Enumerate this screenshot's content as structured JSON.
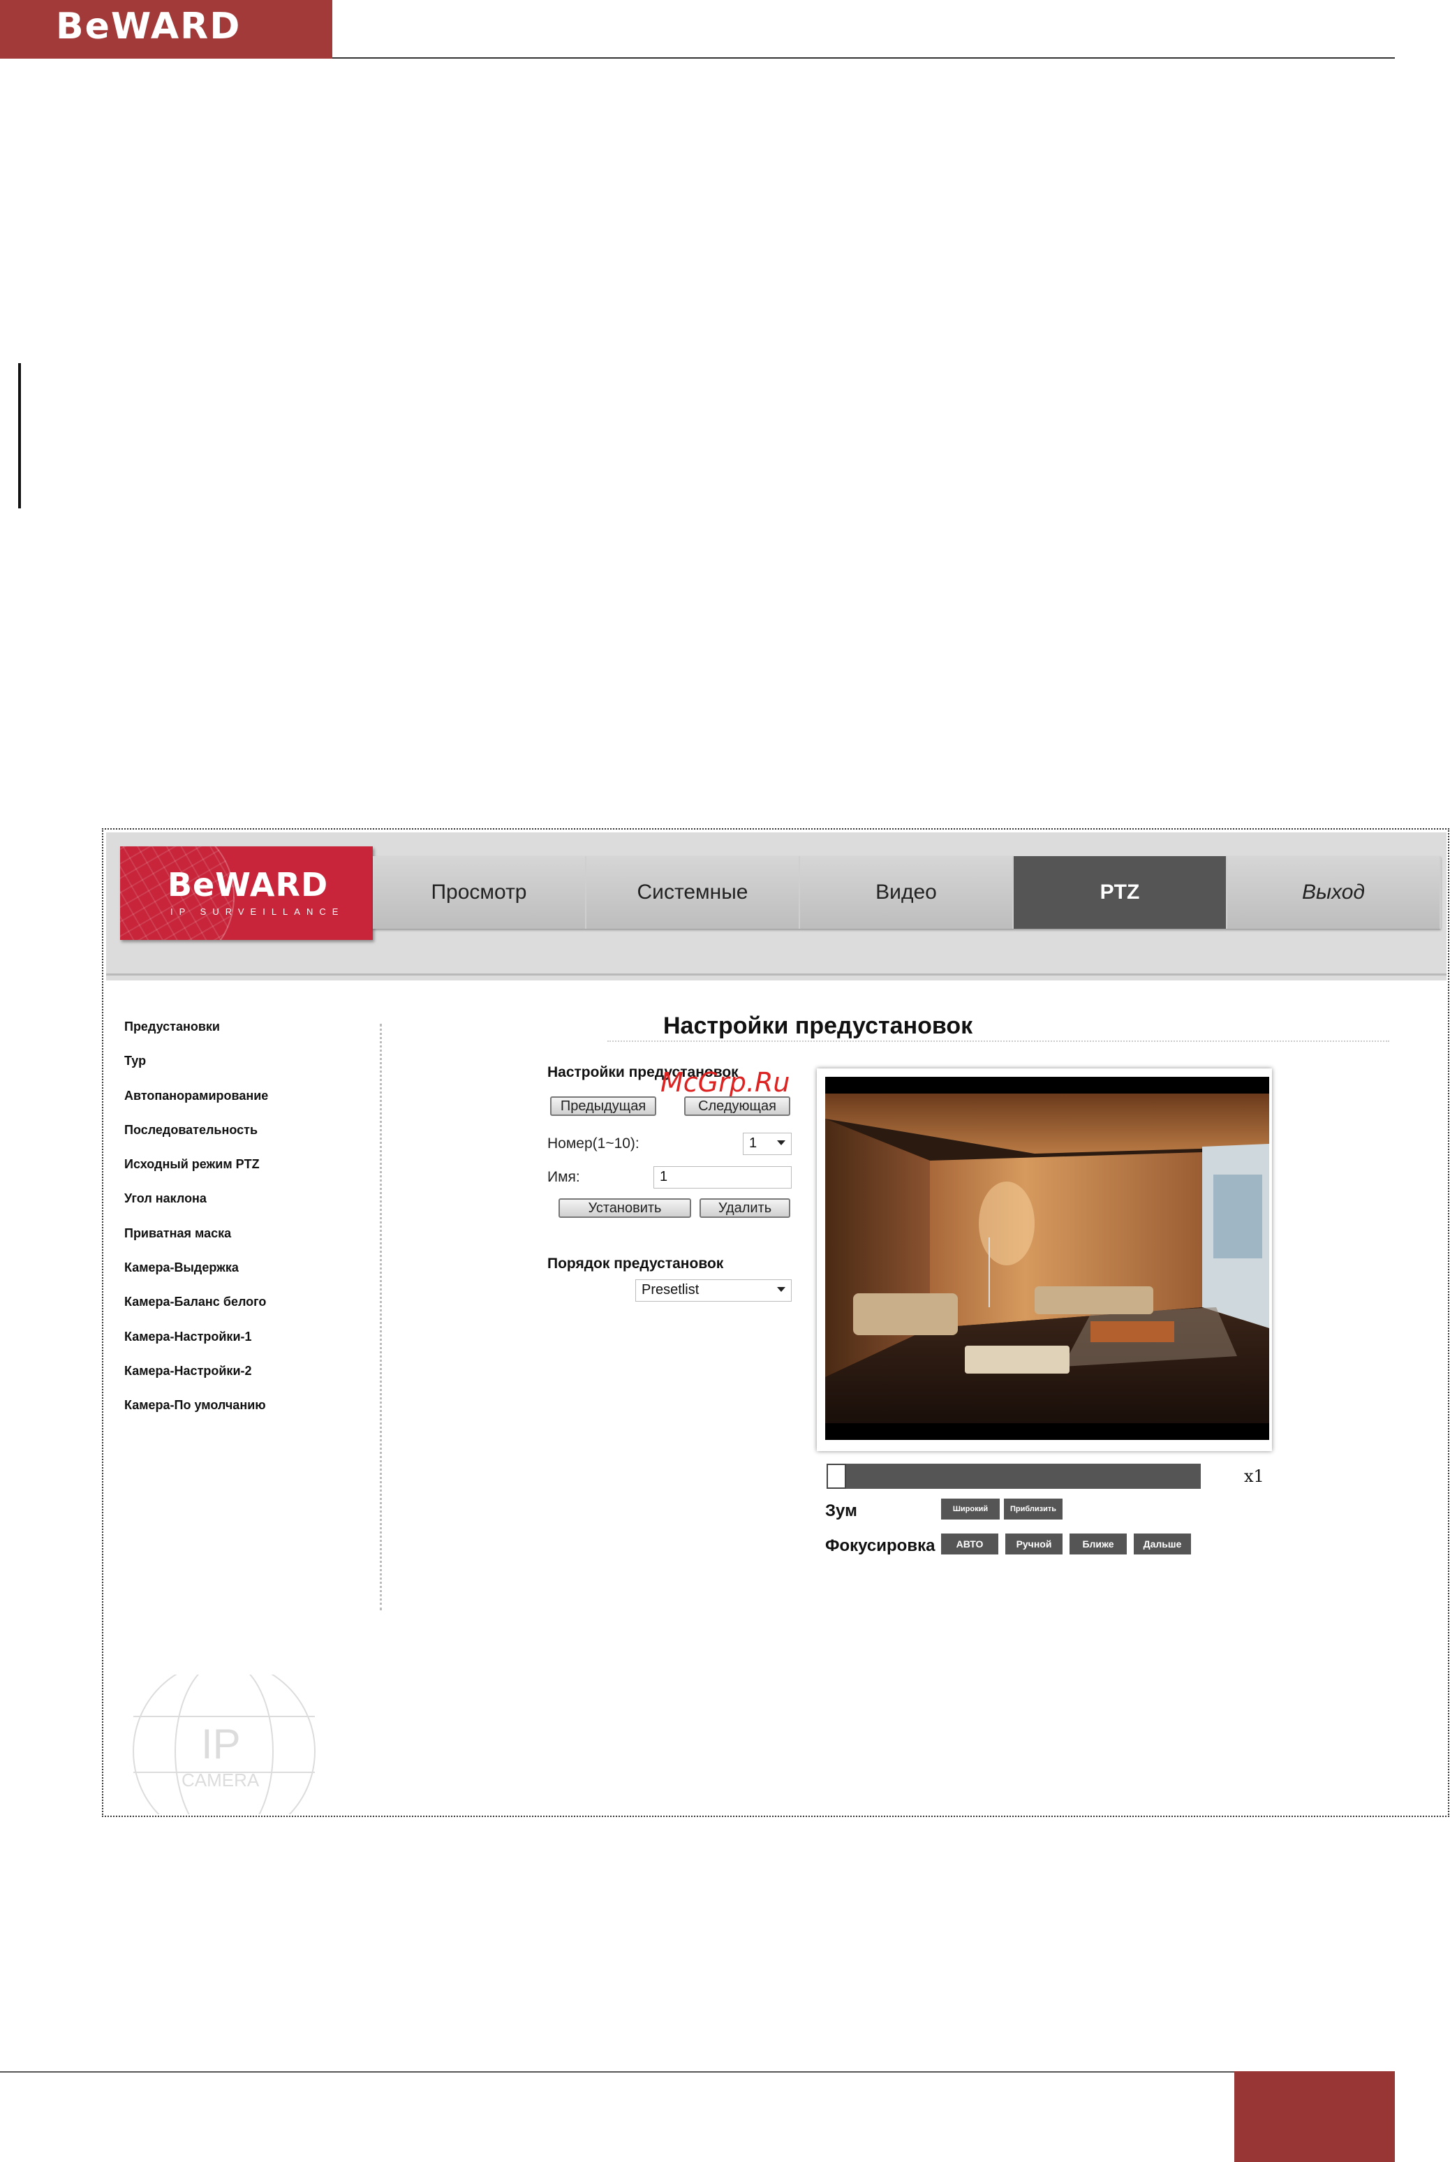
{
  "doc": {
    "brand_logo": "BeWARD",
    "colors": {
      "brand_red": "#a33a3a",
      "camera_red": "#c8243a",
      "active_tab": "#555555"
    }
  },
  "camera_ui": {
    "logo": {
      "name": "BeWARD",
      "tagline": "IP SURVEILLANCE"
    },
    "tabs": [
      {
        "label": "Просмотр",
        "active": false
      },
      {
        "label": "Системные",
        "active": false
      },
      {
        "label": "Видео",
        "active": false
      },
      {
        "label": "PTZ",
        "active": true
      },
      {
        "label": "Выход",
        "active": false
      }
    ],
    "menu": [
      "Предустановки",
      "Тур",
      "Автопанорамирование",
      "Последовательность",
      "Исходный режим PTZ",
      "Угол наклона",
      "Приватная маска",
      "Камера-Выдержка",
      "Камера-Баланс белого",
      "Камера-Настройки-1",
      "Камера-Настройки-2",
      "Камера-По умолчанию"
    ],
    "heading": "Настройки предустановок",
    "preset_section": {
      "title": "Настройки предустановок",
      "prev_button": "Предыдущая",
      "next_button": "Следующая",
      "number_label": "Номер(1~10):",
      "number_value": "1",
      "name_label": "Имя:",
      "name_value": "1",
      "set_button": "Установить",
      "delete_button": "Удалить"
    },
    "order_section": {
      "title": "Порядок предустановок",
      "select_value": "Presetlist"
    },
    "overlay_watermark": "McGrp.Ru",
    "controls": {
      "zoom_level": "x1",
      "zoom_position": 0,
      "zoom_label": "Зум",
      "zoom_wide": "Широкий",
      "zoom_tele": "Приблизить",
      "focus_label": "Фокусировка",
      "focus_auto": "АВТО",
      "focus_manual": "Ручной",
      "focus_near": "Ближе",
      "focus_far": "Дальше"
    },
    "corner_watermark": {
      "line1": "IP",
      "line2": "CAMERA"
    }
  }
}
